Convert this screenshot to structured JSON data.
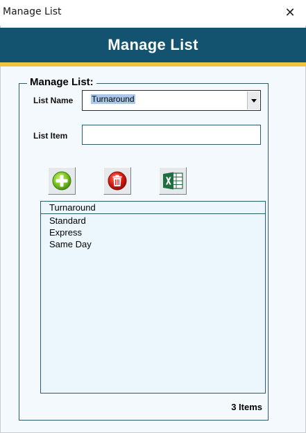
{
  "window": {
    "title": "Manage List",
    "close_glyph": "✕"
  },
  "header": {
    "title": "Manage List",
    "band_color": "#13536f",
    "stripe_color": "#f0c43a"
  },
  "form": {
    "group_label": "Manage List:",
    "list_name_label": "List Name",
    "list_name_value": "Turnaround",
    "list_item_label": "List Item",
    "list_item_value": ""
  },
  "toolbar": {
    "buttons": [
      {
        "name": "add",
        "icon": "plus-icon"
      },
      {
        "name": "delete",
        "icon": "trash-icon"
      },
      {
        "name": "export",
        "icon": "excel-icon"
      }
    ]
  },
  "list": {
    "header": "Turnaround",
    "items": [
      "Standard",
      "Express",
      "Same Day"
    ]
  },
  "footer": {
    "count_text": "3 Items"
  }
}
